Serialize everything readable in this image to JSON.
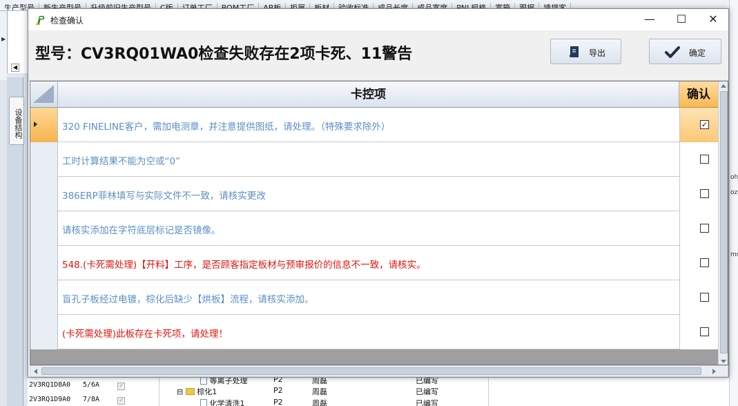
{
  "background_app": {
    "columns": [
      "生产型号",
      "新生产型号",
      "升级前旧生产型号",
      "C版",
      "订单工厂",
      "BOM工厂",
      "AB板",
      "拒厚",
      "板材",
      "验收标准",
      "成品长度",
      "成品宽度",
      "PNL规格",
      "宽箱",
      "跟据",
      "墙增客"
    ],
    "side_tab": "设备结构",
    "right_fragments": [
      "oh",
      "oz",
      "mm"
    ],
    "list_rows": [
      {
        "model": "2V3RQ1D8A0",
        "count": "5/6A",
        "checked": "✓"
      },
      {
        "model": "2V3RQ1D9A0",
        "count": "7/8A",
        "checked": "✓"
      }
    ],
    "tree_items": [
      {
        "name": "等离子处理",
        "code": "P2",
        "owner": "周磊",
        "status": "已编写"
      },
      {
        "name": "棕化1",
        "code": "P2",
        "owner": "周磊",
        "status": "已编写"
      },
      {
        "name": "化学清洗1",
        "code": "P2",
        "owner": "周磊",
        "status": "已编写"
      }
    ]
  },
  "dialog": {
    "window_title": "检查确认",
    "heading": "型号：CV3RQ01WA0检查失败存在2项卡死、11警告",
    "export_label": "导出",
    "confirm_label": "确定",
    "icons": {
      "app": "app-p-icon",
      "export": "book-icon",
      "confirm": "checkmark-icon",
      "minimize": "minimize-icon",
      "maximize": "maximize-icon",
      "close": "close-icon"
    },
    "controls": {
      "minimize": "—",
      "maximize": "☐",
      "close": "✕"
    }
  },
  "grid": {
    "col_check": "卡控项",
    "col_confirm": "确认",
    "rows": [
      {
        "text": "320 FINELINE客户，需加电测章，并注意提供图纸，请处理。（特殊要求除外）",
        "severity": "warning",
        "checked": true,
        "current": true
      },
      {
        "text": "工时计算结果不能为空或“0”",
        "severity": "warning",
        "checked": false,
        "current": false
      },
      {
        "text": "386ERP菲林填写与实际文件不一致，请核实更改",
        "severity": "warning",
        "checked": false,
        "current": false
      },
      {
        "text": "请核实添加在字符底层标记是否镜像。",
        "severity": "warning",
        "checked": false,
        "current": false
      },
      {
        "text": "548.(卡死需处理)【开料】工序，是否顾客指定板材与预审报价的信息不一致，请核实。",
        "severity": "blocking",
        "checked": false,
        "current": false
      },
      {
        "text": "盲孔子板经过电镀，棕化后缺少【烘板】流程，请核实添加。",
        "severity": "warning",
        "checked": false,
        "current": false
      },
      {
        "text": "(卡死需处理)此板存在卡死项，请处理！",
        "severity": "blocking",
        "checked": false,
        "current": false
      }
    ],
    "colors": {
      "warning": "#5b8fc6",
      "blocking": "#e0160e",
      "confirm_header": "#f7b955"
    }
  }
}
